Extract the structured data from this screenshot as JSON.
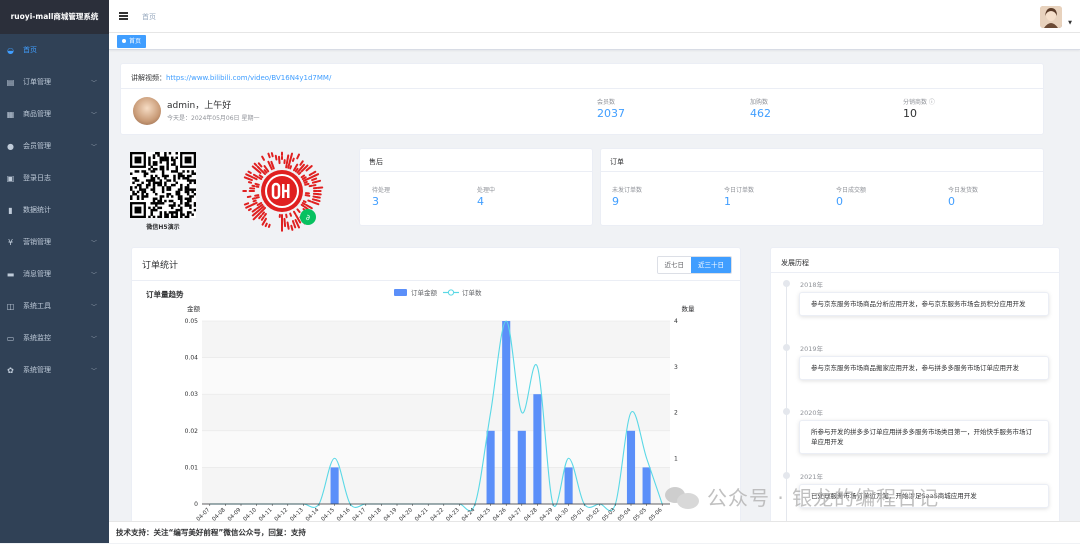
{
  "app": {
    "title": "ruoyi-mall商城管理系统"
  },
  "sidebar": {
    "items": [
      {
        "label": "首页",
        "icon": "dashboard-icon",
        "glyph": "◒",
        "active": true,
        "arrow": ""
      },
      {
        "label": "订单管理",
        "icon": "order-icon",
        "glyph": "▤",
        "arrow": "﹀"
      },
      {
        "label": "商品管理",
        "icon": "goods-icon",
        "glyph": "▦",
        "arrow": "﹀"
      },
      {
        "label": "会员管理",
        "icon": "user-icon",
        "glyph": "●",
        "arrow": "﹀"
      },
      {
        "label": "登录日志",
        "icon": "log-icon",
        "glyph": "▣",
        "arrow": ""
      },
      {
        "label": "数据统计",
        "icon": "chart-icon",
        "glyph": "▮",
        "arrow": ""
      },
      {
        "label": "营销管理",
        "icon": "yen-icon",
        "glyph": "¥",
        "arrow": "﹀"
      },
      {
        "label": "消息管理",
        "icon": "message-icon",
        "glyph": "▬",
        "arrow": "﹀"
      },
      {
        "label": "系统工具",
        "icon": "tool-icon",
        "glyph": "◫",
        "arrow": "﹀"
      },
      {
        "label": "系统监控",
        "icon": "monitor-icon",
        "glyph": "▭",
        "arrow": "﹀"
      },
      {
        "label": "系统管理",
        "icon": "gear-icon",
        "glyph": "✿",
        "arrow": "﹀"
      }
    ]
  },
  "header": {
    "breadcrumb": "首页",
    "avatar_caret": "▼"
  },
  "tags": {
    "home": "首页"
  },
  "info": {
    "video_label": "讲解视频：",
    "video_url": "https://www.bilibili.com/video/BV16N4y1d7MM/",
    "greeting": "admin，上午好",
    "today": "今天是：2024年05月06日 星期一",
    "stats": [
      {
        "label": "会员数",
        "value": "2037",
        "dark": false
      },
      {
        "label": "加购数",
        "value": "462",
        "dark": false
      },
      {
        "label": "分销商数 ⓘ",
        "value": "10",
        "dark": true
      }
    ]
  },
  "qr": {
    "label": "微信H5演示"
  },
  "aftersale": {
    "title": "售后",
    "items": [
      {
        "label": "待处理",
        "value": "3"
      },
      {
        "label": "处理中",
        "value": "4"
      }
    ]
  },
  "orders": {
    "title": "订单",
    "items": [
      {
        "label": "未发订单数",
        "value": "9"
      },
      {
        "label": "今日订单数",
        "value": "1"
      },
      {
        "label": "今日成交额",
        "value": "0"
      },
      {
        "label": "今日发货数",
        "value": "0"
      }
    ]
  },
  "chart_card": {
    "title": "订单统计",
    "tabs": [
      "近七日",
      "近三十日"
    ],
    "active_tab": 1
  },
  "chart_data": {
    "type": "bar",
    "title": "订单量趋势",
    "legend": [
      "订单金额",
      "订单数"
    ],
    "y_left_label": "金额",
    "y_right_label": "数量",
    "y_left_ticks": [
      "0",
      "0.01",
      "0.02",
      "0.03",
      "0.04",
      "0.05"
    ],
    "y_right_ticks": [
      "1",
      "2",
      "3",
      "4"
    ],
    "ylim_left": [
      0,
      0.05
    ],
    "ylim_right": [
      0,
      4
    ],
    "categories": [
      "2024-04-07",
      "2024-04-08",
      "2024-04-09",
      "2024-04-10",
      "2024-04-11",
      "2024-04-12",
      "2024-04-13",
      "2024-04-14",
      "2024-04-15",
      "2024-04-16",
      "2024-04-17",
      "2024-04-18",
      "2024-04-19",
      "2024-04-20",
      "2024-04-21",
      "2024-04-22",
      "2024-04-23",
      "2024-04-24",
      "2024-04-25",
      "2024-04-26",
      "2024-04-27",
      "2024-04-28",
      "2024-04-29",
      "2024-04-30",
      "2024-05-01",
      "2024-05-02",
      "2024-05-03",
      "2024-05-04",
      "2024-05-05",
      "2024-05-06"
    ],
    "tick_labels": [
      "04-07",
      "04-08",
      "04-09",
      "04-10",
      "04-11",
      "04-12",
      "04-13",
      "04-14",
      "04-15",
      "04-16",
      "04-17",
      "04-18",
      "04-19",
      "04-20",
      "04-21",
      "04-22",
      "04-23",
      "04-24",
      "04-25",
      "04-26",
      "04-27",
      "04-28",
      "04-29",
      "04-30",
      "05-01",
      "05-02",
      "05-03",
      "05-04",
      "05-05",
      "05-06"
    ],
    "series": [
      {
        "name": "订单金额",
        "type": "bar",
        "color": "#5b8ff9",
        "values": [
          0,
          0,
          0,
          0,
          0,
          0,
          0,
          0,
          0.01,
          0,
          0,
          0,
          0,
          0,
          0,
          0,
          0,
          0,
          0.02,
          0.05,
          0.02,
          0.03,
          0,
          0.01,
          0,
          0,
          0,
          0.02,
          0.01,
          0
        ]
      },
      {
        "name": "订单数",
        "type": "line",
        "color": "#5ad8e6",
        "values": [
          0,
          0,
          0,
          0,
          0,
          0,
          0,
          0,
          1,
          0,
          0,
          0,
          0,
          0,
          0,
          0,
          0,
          0,
          2,
          4,
          2,
          3,
          0,
          1,
          0,
          0,
          0,
          2,
          1,
          0
        ]
      }
    ],
    "grid": true,
    "legend_position": "top-center"
  },
  "timeline": {
    "title": "发展历程",
    "items": [
      {
        "year": "2018年",
        "text": "参与京东服务市场商品分析应用开发，参与京东服务市场会员积分应用开发"
      },
      {
        "year": "2019年",
        "text": "参与京东服务市场商品搬家应用开发，参与拼多多服务市场订单应用开发"
      },
      {
        "year": "2020年",
        "text": "所参与开发的拼多多订单应用拼多多服务市场类目第一，开始快手服务市场订单应用开发"
      },
      {
        "year": "2021年",
        "text": "已处理服务市场订单近万笔，开始涉足SaaS商城应用开发"
      }
    ]
  },
  "footer": {
    "text": "技术支持：关注“编写美好前程”微信公众号，回复：支持"
  },
  "watermark": {
    "text": "公众号 · 银龙的编程日记"
  }
}
